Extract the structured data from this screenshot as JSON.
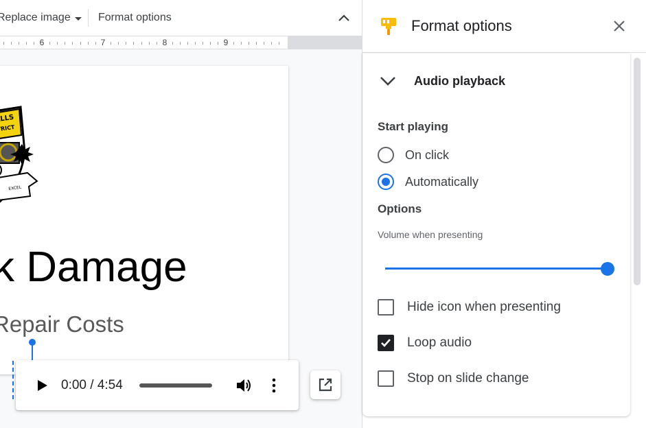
{
  "toolbar": {
    "replace_image_label": "Replace image",
    "format_options_label": "Format options"
  },
  "ruler": {
    "numbers": [
      "6",
      "7",
      "8",
      "9"
    ]
  },
  "slide": {
    "title": "k Damage",
    "subtitle": "Repair Costs",
    "logo_text": [
      "FALLS",
      "STRICT",
      "EXCEL"
    ]
  },
  "audio_player": {
    "time": "0:00 / 4:54",
    "progress": 0
  },
  "panel": {
    "title": "Format options",
    "section_title": "Audio playback",
    "start_playing_label": "Start playing",
    "start_options": [
      {
        "label": "On click",
        "selected": false
      },
      {
        "label": "Automatically",
        "selected": true
      }
    ],
    "options_label": "Options",
    "volume_label": "Volume when presenting",
    "volume": 1.0,
    "checkboxes": [
      {
        "label": "Hide icon when presenting",
        "checked": false
      },
      {
        "label": "Loop audio",
        "checked": true
      },
      {
        "label": "Stop on slide change",
        "checked": false
      }
    ]
  },
  "colors": {
    "accent": "#1a73e8",
    "panel_icon": "#fbbc04",
    "checkbox_checked": "#202124"
  },
  "icons": {
    "panel_header": "paint-roller-icon",
    "close": "close-icon",
    "collapse": "chevron-up-icon",
    "section": "chevron-down-icon",
    "play": "play-icon",
    "volume": "volume-icon",
    "more": "more-vertical-icon",
    "open": "open-in-new-icon"
  }
}
